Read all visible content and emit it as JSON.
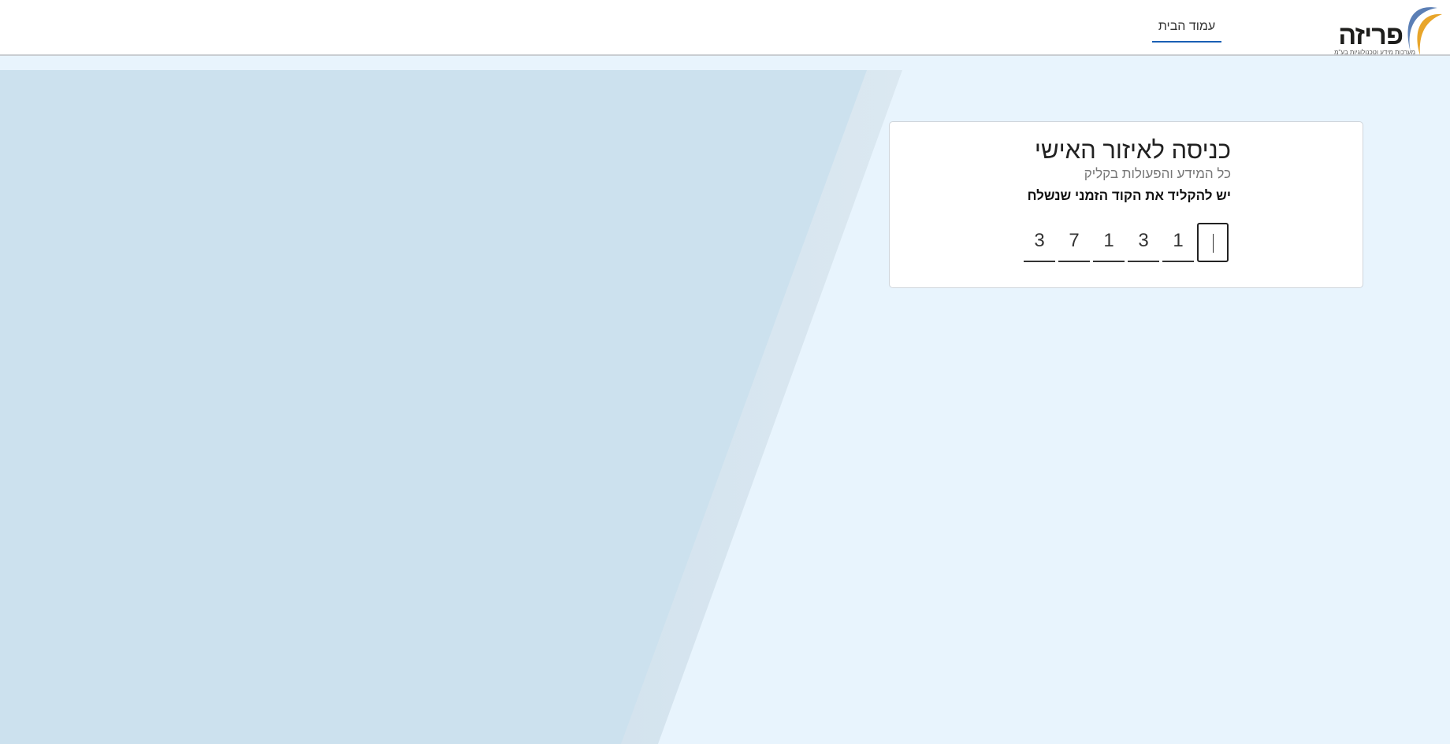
{
  "header": {
    "brand_name": "פריזה",
    "brand_tagline": "מערכות מידע וטכנולוגיות בע\"מ",
    "nav_home": "עמוד הבית",
    "nav_accent_color": "#1a5fb4"
  },
  "login_card": {
    "title": "כניסה לאיזור האישי",
    "subtitle": "כל המידע והפעולות בקליק",
    "instruction": "יש להקליד את הקוד הזמני שנשלח",
    "otp_digits": [
      "",
      "1",
      "3",
      "1",
      "7",
      "3"
    ]
  },
  "colors": {
    "page_background": "#e8f4fd",
    "slant_panel": "#cce1ee",
    "logo_blue": "#5b7fb5",
    "logo_orange": "#e8a52a"
  }
}
